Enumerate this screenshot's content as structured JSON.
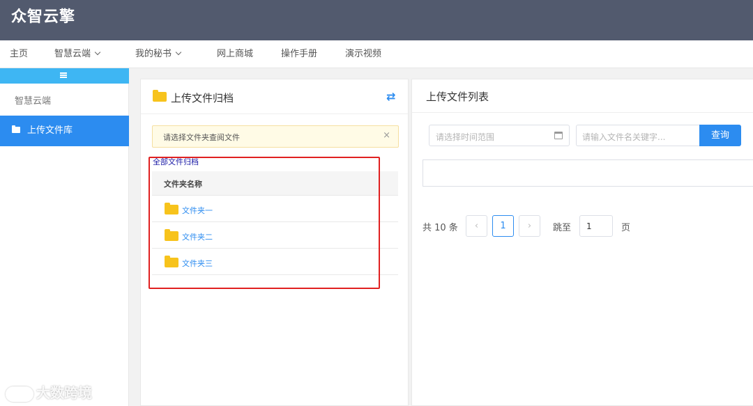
{
  "app": {
    "logo": "众智云擎"
  },
  "nav": {
    "items": [
      {
        "label": "主页"
      },
      {
        "label": "智慧云端"
      },
      {
        "label": "我的秘书"
      },
      {
        "label": "网上商城"
      },
      {
        "label": "操作手册"
      },
      {
        "label": "演示视频"
      }
    ]
  },
  "sidebar": {
    "category": "智慧云端",
    "active_item": "上传文件库"
  },
  "archive_panel": {
    "title": "上传文件归档",
    "alert": "请选择文件夹查阅文件",
    "all_link": "全部文件归档",
    "column_header": "文件夹名称",
    "folders": [
      {
        "name": "文件夹一"
      },
      {
        "name": "文件夹二"
      },
      {
        "name": "文件夹三"
      }
    ]
  },
  "list_panel": {
    "title": "上传文件列表",
    "date_placeholder": "请选择时间范围",
    "keyword_placeholder": "请输入文件名关键字...",
    "query_label": "查询"
  },
  "pagination": {
    "total_text": "共 10 条",
    "current_page": "1",
    "jump_label": "跳至",
    "jump_value": "1",
    "page_suffix": "页"
  },
  "watermark": {
    "text": "大数跨境"
  },
  "colors": {
    "accent": "#2c8cf0",
    "topbar": "#525a6e",
    "folder": "#f7c31c",
    "highlight_border": "#e02020"
  }
}
